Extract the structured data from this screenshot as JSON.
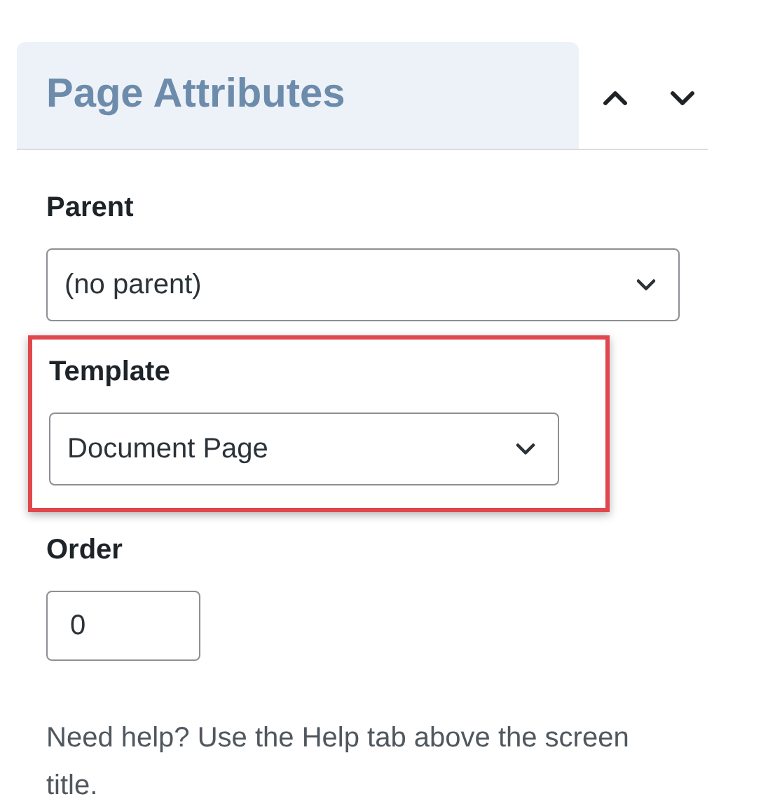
{
  "panel": {
    "title": "Page Attributes"
  },
  "fields": [
    {
      "kind": "select",
      "label": "Parent",
      "value": "(no parent)",
      "highlighted": false
    },
    {
      "kind": "select",
      "label": "Template",
      "value": "Document Page",
      "highlighted": true
    },
    {
      "kind": "input",
      "label": "Order",
      "value": "0",
      "highlighted": false
    }
  ],
  "help": "Need help? Use the Help tab above the screen title."
}
